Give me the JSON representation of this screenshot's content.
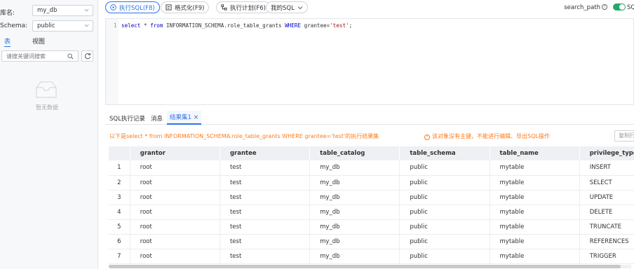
{
  "sidebar": {
    "db_label": "库名:",
    "db_value": "my_db",
    "schema_label": "Schema:",
    "schema_value": "public",
    "tabs": [
      {
        "label": "表"
      },
      {
        "label": "视图"
      }
    ],
    "search_placeholder": "请搜关键词搜索",
    "empty_text": "暂无数据"
  },
  "toolbar": {
    "run_label": "执行SQL(F8)",
    "format_label": "格式化(F9)",
    "plan_label": "执行计划(F6)",
    "mysql_label": "我的SQL",
    "search_path_label": "search_path",
    "right_cut_label": "SQ"
  },
  "editor": {
    "line_number": "1",
    "sql": "select * from INFORMATION_SCHEMA.role_table_grants WHERE grantee='test';"
  },
  "results": {
    "tabs": [
      {
        "label": "SQL执行记录"
      },
      {
        "label": "消息"
      },
      {
        "label": "结果集1"
      }
    ],
    "summary": "以下是select * from INFORMATION_SCHEMA.role_table_grants WHERE grantee='test'的执行结果集",
    "warning": "该对象没有主键，不能进行编辑、导出SQL操作",
    "copy_label": "复制行",
    "columns": [
      "grantor",
      "grantee",
      "table_catalog",
      "table_schema",
      "table_name",
      "privilege_type"
    ],
    "rows": [
      [
        "1",
        "root",
        "test",
        "my_db",
        "public",
        "mytable",
        "INSERT"
      ],
      [
        "2",
        "root",
        "test",
        "my_db",
        "public",
        "mytable",
        "SELECT"
      ],
      [
        "3",
        "root",
        "test",
        "my_db",
        "public",
        "mytable",
        "UPDATE"
      ],
      [
        "4",
        "root",
        "test",
        "my_db",
        "public",
        "mytable",
        "DELETE"
      ],
      [
        "5",
        "root",
        "test",
        "my_db",
        "public",
        "mytable",
        "TRUNCATE"
      ],
      [
        "6",
        "root",
        "test",
        "my_db",
        "public",
        "mytable",
        "REFERENCES"
      ],
      [
        "7",
        "root",
        "test",
        "my_db",
        "public",
        "mytable",
        "TRIGGER"
      ]
    ]
  },
  "colors": {
    "accent": "#2d73e6",
    "warning": "#ff7a1a",
    "toggle_on": "#27a86b"
  }
}
